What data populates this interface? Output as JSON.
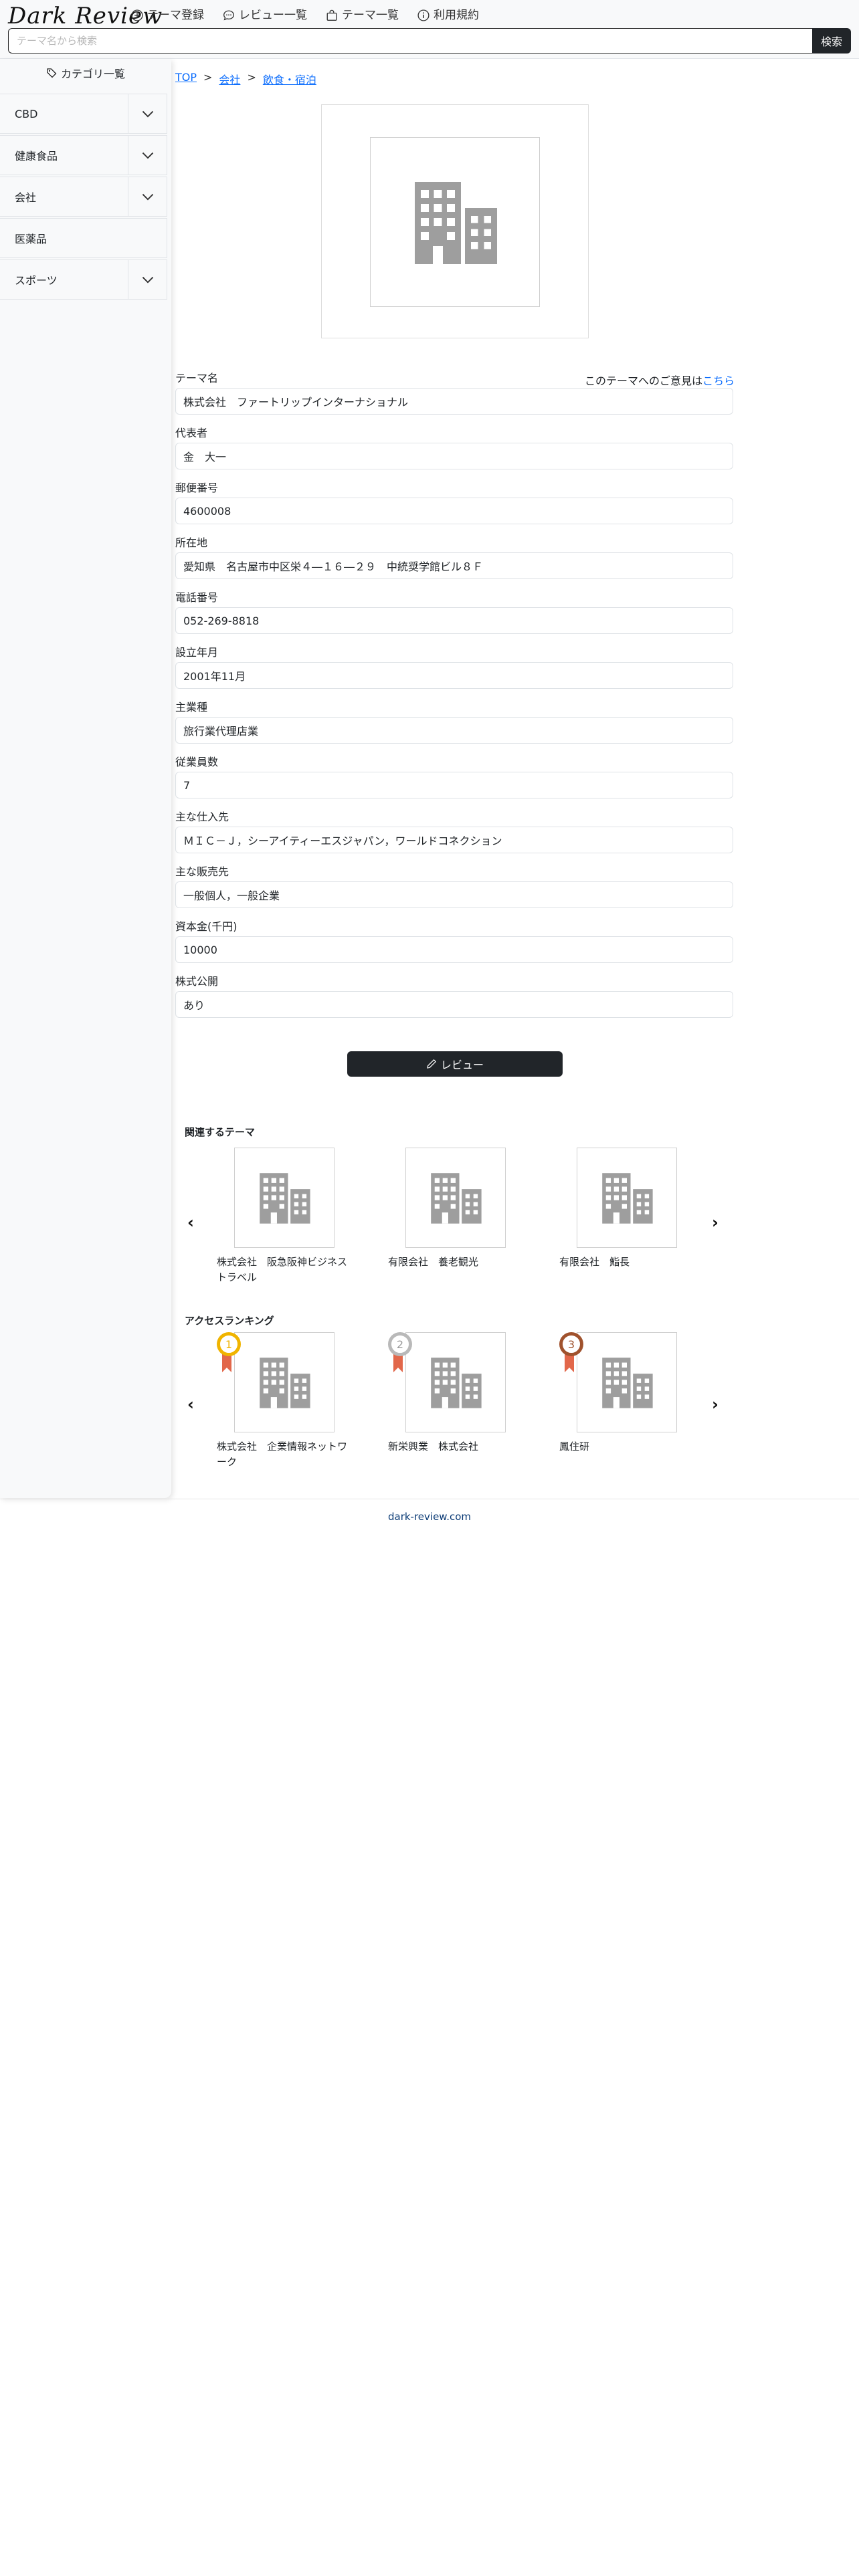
{
  "header": {
    "logo": "Dark Review",
    "nav": [
      {
        "label": "テーマ登録",
        "icon": "plus-circle-icon"
      },
      {
        "label": "レビュー一覧",
        "icon": "chat-icon"
      },
      {
        "label": "テーマ一覧",
        "icon": "bag-icon"
      },
      {
        "label": "利用規約",
        "icon": "info-circle-icon"
      }
    ],
    "search": {
      "placeholder": "テーマ名から検索",
      "button": "検索"
    }
  },
  "sidebar": {
    "title": "カテゴリ一覧",
    "items": [
      {
        "label": "CBD",
        "expandable": true
      },
      {
        "label": "健康食品",
        "expandable": true
      },
      {
        "label": "会社",
        "expandable": true
      },
      {
        "label": "医薬品",
        "expandable": false
      },
      {
        "label": "スポーツ",
        "expandable": true
      }
    ]
  },
  "breadcrumb": [
    "TOP",
    "会社",
    "飲食・宿泊"
  ],
  "breadcrumb_sep": ">",
  "opinion": {
    "text": "このテーマへのご意見は",
    "link": "こちら"
  },
  "fields": [
    {
      "label": "テーマ名",
      "value": "株式会社　ファートリップインターナショナル"
    },
    {
      "label": "代表者",
      "value": "金　大一"
    },
    {
      "label": "郵便番号",
      "value": "4600008"
    },
    {
      "label": "所在地",
      "value": "愛知県　名古屋市中区栄４―１６―２９　中統奨学館ビル８Ｆ"
    },
    {
      "label": "電話番号",
      "value": "052-269-8818"
    },
    {
      "label": "設立年月",
      "value": "2001年11月"
    },
    {
      "label": "主業種",
      "value": "旅行業代理店業"
    },
    {
      "label": "従業員数",
      "value": "7"
    },
    {
      "label": "主な仕入先",
      "value": "ＭＩＣ－Ｊ，シーアイティーエスジャパン，ワールドコネクション"
    },
    {
      "label": "主な販売先",
      "value": "一般個人，一般企業"
    },
    {
      "label": "資本金(千円)",
      "value": "10000"
    },
    {
      "label": "株式公開",
      "value": "あり"
    }
  ],
  "review_button": "レビュー",
  "related": {
    "title": "関連するテーマ",
    "items": [
      "株式会社　阪急阪神ビジネストラベル",
      "有限会社　養老観光",
      "有限会社　鮨長"
    ]
  },
  "ranking": {
    "title": "アクセスランキング",
    "items": [
      {
        "rank": "1",
        "label": "株式会社　企業情報ネットワーク"
      },
      {
        "rank": "2",
        "label": "新栄興業　株式会社"
      },
      {
        "rank": "3",
        "label": "鳳住研"
      }
    ]
  },
  "arrows": {
    "prev": "‹",
    "next": "›"
  },
  "footer": "dark-review.com",
  "colors": {
    "accent": "#0d6efd",
    "dark": "#212529",
    "gold": "#f0b400",
    "silver": "#b9b9b9",
    "bronze": "#b5651d",
    "ribbon": "#e2674a"
  }
}
